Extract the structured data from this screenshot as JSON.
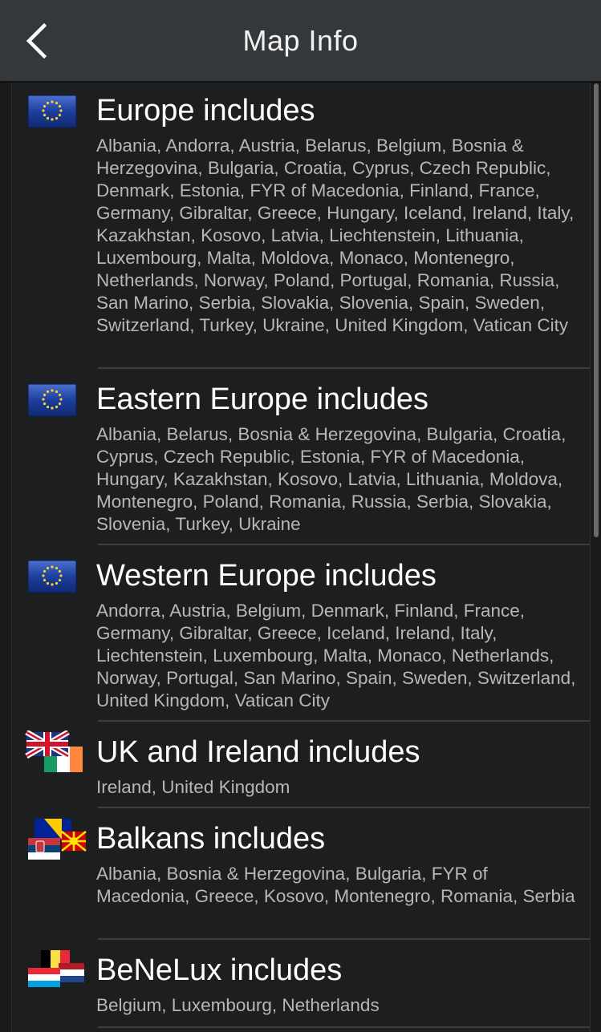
{
  "appbar": {
    "title": "Map Info",
    "back_icon": "chevron-left-icon"
  },
  "colors": {
    "appbar": "#35383b",
    "background": "#1d1e1f",
    "eu_blue": "#1d3f9c",
    "star_yellow": "#f7d23c",
    "list_text": "#b7b7b7"
  },
  "entries": [
    {
      "title": "Europe includes",
      "flag": "eu-flag-icon",
      "countries": "Albania, Andorra, Austria, Belarus, Belgium, Bosnia & Herzegovina, Bulgaria, Croatia, Cyprus, Czech Republic, Denmark, Estonia, FYR of Macedonia, Finland, France, Germany, Gibraltar, Greece, Hungary, Iceland, Ireland, Italy, Kazakhstan, Kosovo, Latvia, Liechtenstein, Lithuania, Luxembourg, Malta, Moldova, Monaco, Montenegro, Netherlands, Norway, Poland, Portugal, Romania, Russia, San Marino, Serbia, Slovakia, Slovenia, Spain, Sweden, Switzerland, Turkey, Ukraine, United Kingdom, Vatican City"
    },
    {
      "title": "Eastern Europe includes",
      "flag": "eu-flag-icon",
      "countries": "Albania, Belarus, Bosnia & Herzegovina, Bulgaria, Croatia, Cyprus, Czech Republic, Estonia, FYR of Macedonia, Hungary, Kazakhstan, Kosovo, Latvia, Lithuania, Moldova, Montenegro, Poland, Romania, Russia, Serbia, Slovakia, Slovenia, Turkey, Ukraine"
    },
    {
      "title": "Western Europe includes",
      "flag": "eu-flag-icon",
      "countries": "Andorra, Austria, Belgium, Denmark, Finland, France, Germany, Gibraltar, Greece, Iceland, Ireland, Italy, Liechtenstein, Luxembourg, Malta, Monaco, Netherlands, Norway, Portugal, San Marino, Spain, Sweden, Switzerland, United Kingdom, Vatican City"
    },
    {
      "title": "UK and Ireland includes",
      "flag": "uk-ireland-flags-icon",
      "countries": "Ireland, United Kingdom"
    },
    {
      "title": "Balkans includes",
      "flag": "balkans-flags-icon",
      "countries": "Albania, Bosnia & Herzegovina, Bulgaria, FYR of Macedonia, Greece, Kosovo, Montenegro, Romania, Serbia"
    },
    {
      "title": "BeNeLux includes",
      "flag": "benelux-flags-icon",
      "countries": "Belgium, Luxembourg, Netherlands"
    }
  ]
}
